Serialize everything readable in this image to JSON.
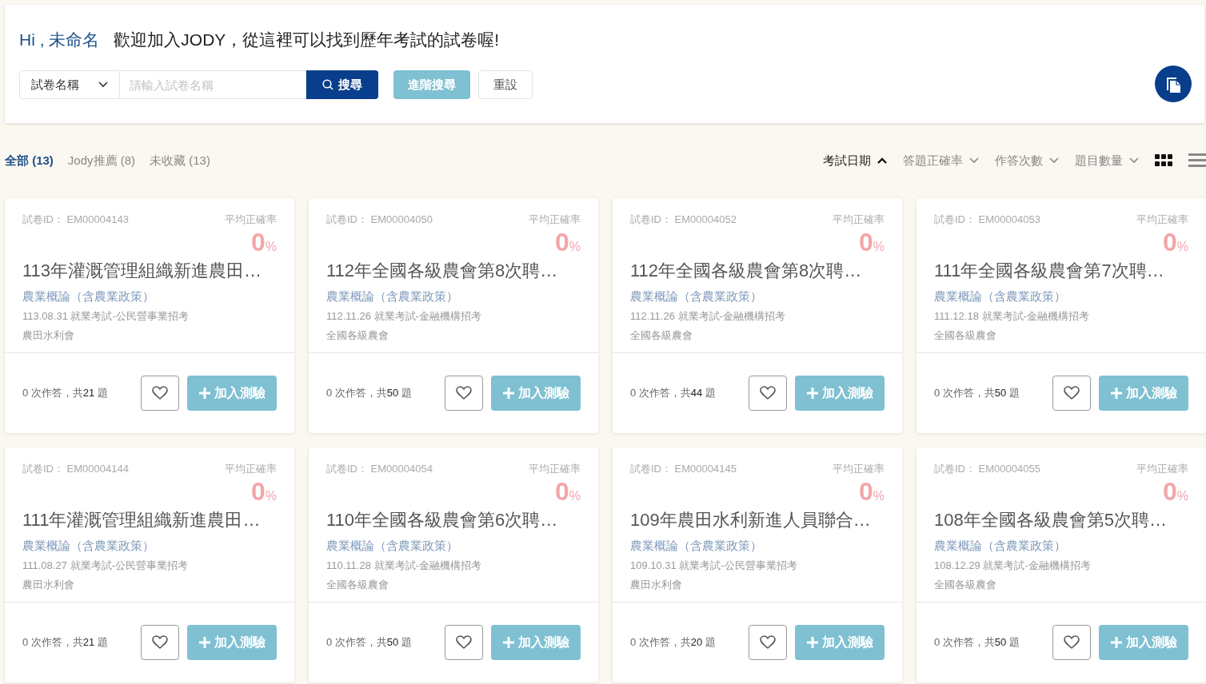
{
  "header": {
    "greeting": "Hi , 未命名",
    "welcome": "歡迎加入JODY，從這裡可以找到歷年考試的試卷喔!"
  },
  "search": {
    "field_select": "試卷名稱",
    "placeholder": "請輸入試卷名稱",
    "search_button": "搜尋",
    "advanced_button": "進階搜尋",
    "reset_button": "重設"
  },
  "tabs": [
    {
      "label": "全部 (13)",
      "selected": true
    },
    {
      "label": "Jody推薦 (8)",
      "selected": false
    },
    {
      "label": "未收藏 (13)",
      "selected": false
    }
  ],
  "sort_options": [
    {
      "label": "考試日期",
      "selected": true
    },
    {
      "label": "答題正確率",
      "selected": false
    },
    {
      "label": "作答次數",
      "selected": false
    },
    {
      "label": "題目數量",
      "selected": false
    }
  ],
  "view_modes": [
    {
      "kind": "grid",
      "selected": true
    },
    {
      "kind": "list",
      "selected": false
    }
  ],
  "cards": [
    {
      "paper_id": "試卷ID： EM00004143",
      "rate_label": "平均正確率",
      "rate": "0",
      "unit": "%",
      "title": "113年灌溉管理組織新進農田…",
      "subject": "農業概論（含農業政策）",
      "exam": "113.08.31 就業考試-公民營事業招考",
      "organization": "農田水利會",
      "attempts": "0 次作答，共",
      "questions": "21",
      "questions_unit": " 題",
      "favorited": false,
      "add_button": "加入測驗"
    },
    {
      "paper_id": "試卷ID： EM00004050",
      "rate_label": "平均正確率",
      "rate": "0",
      "unit": "%",
      "title": "112年全國各級農會第8次聘…",
      "subject": "農業概論（含農業政策）",
      "exam": "112.11.26 就業考試-金融機構招考",
      "organization": "全國各級農會",
      "attempts": "0 次作答，共",
      "questions": "50",
      "questions_unit": " 題",
      "favorited": false,
      "add_button": "加入測驗"
    },
    {
      "paper_id": "試卷ID： EM00004052",
      "rate_label": "平均正確率",
      "rate": "0",
      "unit": "%",
      "title": "112年全國各級農會第8次聘…",
      "subject": "農業概論（含農業政策）",
      "exam": "112.11.26 就業考試-金融機構招考",
      "organization": "全國各級農會",
      "attempts": "0 次作答，共",
      "questions": "44",
      "questions_unit": " 題",
      "favorited": false,
      "add_button": "加入測驗"
    },
    {
      "paper_id": "試卷ID： EM00004053",
      "rate_label": "平均正確率",
      "rate": "0",
      "unit": "%",
      "title": "111年全國各級農會第7次聘…",
      "subject": "農業概論（含農業政策）",
      "exam": "111.12.18 就業考試-金融機構招考",
      "organization": "全國各級農會",
      "attempts": "0 次作答，共",
      "questions": "50",
      "questions_unit": " 題",
      "favorited": false,
      "add_button": "加入測驗"
    },
    {
      "paper_id": "試卷ID： EM00004144",
      "rate_label": "平均正確率",
      "rate": "0",
      "unit": "%",
      "title": "111年灌溉管理組織新進農田…",
      "subject": "農業概論（含農業政策）",
      "exam": "111.08.27 就業考試-公民營事業招考",
      "organization": "農田水利會",
      "attempts": "0 次作答，共",
      "questions": "21",
      "questions_unit": " 題",
      "favorited": false,
      "add_button": "加入測驗"
    },
    {
      "paper_id": "試卷ID： EM00004054",
      "rate_label": "平均正確率",
      "rate": "0",
      "unit": "%",
      "title": "110年全國各級農會第6次聘…",
      "subject": "農業概論（含農業政策）",
      "exam": "110.11.28 就業考試-金融機構招考",
      "organization": "全國各級農會",
      "attempts": "0 次作答，共",
      "questions": "50",
      "questions_unit": " 題",
      "favorited": false,
      "add_button": "加入測驗"
    },
    {
      "paper_id": "試卷ID： EM00004145",
      "rate_label": "平均正確率",
      "rate": "0",
      "unit": "%",
      "title": "109年農田水利新進人員聯合…",
      "subject": "農業概論（含農業政策）",
      "exam": "109.10.31 就業考試-公民營事業招考",
      "organization": "農田水利會",
      "attempts": "0 次作答，共",
      "questions": "20",
      "questions_unit": " 題",
      "favorited": false,
      "add_button": "加入測驗"
    },
    {
      "paper_id": "試卷ID： EM00004055",
      "rate_label": "平均正確率",
      "rate": "0",
      "unit": "%",
      "title": "108年全國各級農會第5次聘…",
      "subject": "農業概論（含農業政策）",
      "exam": "108.12.29 就業考試-金融機構招考",
      "organization": "全國各級農會",
      "attempts": "0 次作答，共",
      "questions": "50",
      "questions_unit": " 題",
      "favorited": false,
      "add_button": "加入測驗"
    }
  ]
}
